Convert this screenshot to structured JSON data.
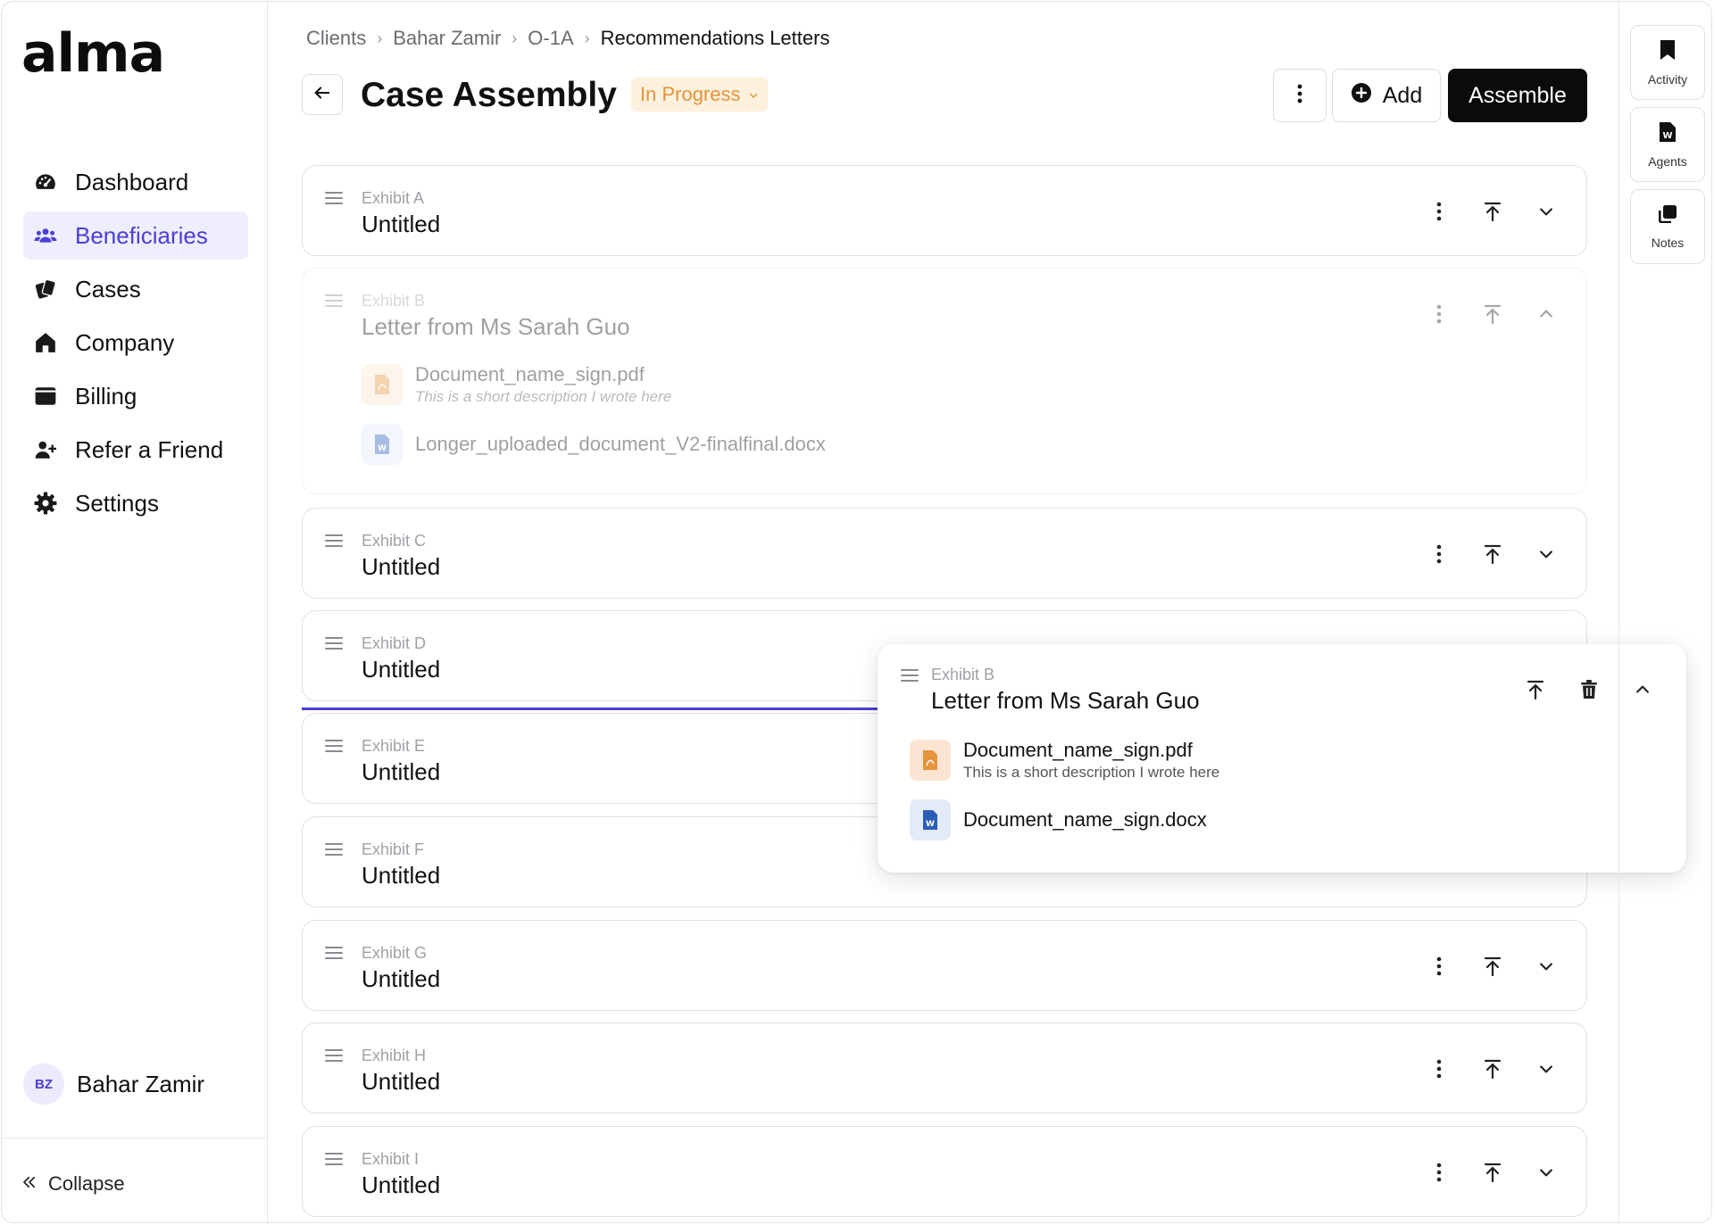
{
  "app": {
    "logo": "alma"
  },
  "sidebar": {
    "items": [
      {
        "label": "Dashboard",
        "icon": "dashboard-gauge-icon"
      },
      {
        "label": "Beneficiaries",
        "icon": "users-icon",
        "active": true
      },
      {
        "label": "Cases",
        "icon": "cases-icon"
      },
      {
        "label": "Company",
        "icon": "home-icon"
      },
      {
        "label": "Billing",
        "icon": "wallet-icon"
      },
      {
        "label": "Refer a Friend",
        "icon": "user-plus-icon"
      },
      {
        "label": "Settings",
        "icon": "gear-icon"
      }
    ],
    "user": {
      "initials": "BZ",
      "name": "Bahar Zamir"
    },
    "collapse_label": "Collapse"
  },
  "breadcrumb": [
    "Clients",
    "Bahar Zamir",
    "O-1A",
    "Recommendations Letters"
  ],
  "header": {
    "title": "Case Assembly",
    "status": "In Progress",
    "add_label": "Add",
    "assemble_label": "Assemble"
  },
  "exhibits": [
    {
      "label": "Exhibit A",
      "title": "Untitled"
    },
    {
      "label": "Exhibit B",
      "title": "Letter from Ms Sarah Guo",
      "docs": [
        {
          "name": "Document_name_sign.pdf",
          "desc": "This is a short description I wrote here"
        },
        {
          "name": "Longer_uploaded_document_V2-finalfinal.docx"
        }
      ]
    },
    {
      "label": "Exhibit C",
      "title": "Untitled"
    },
    {
      "label": "Exhibit D",
      "title": "Untitled"
    },
    {
      "label": "Exhibit E",
      "title": "Untitled"
    },
    {
      "label": "Exhibit F",
      "title": "Untitled"
    },
    {
      "label": "Exhibit G",
      "title": "Untitled"
    },
    {
      "label": "Exhibit H",
      "title": "Untitled"
    },
    {
      "label": "Exhibit I",
      "title": "Untitled"
    }
  ],
  "dragging": {
    "label": "Exhibit B",
    "title": "Letter from Ms Sarah Guo",
    "docs": [
      {
        "name": "Document_name_sign.pdf",
        "desc": "This is a short description I wrote here"
      },
      {
        "name": "Document_name_sign.docx"
      }
    ]
  },
  "rail": [
    {
      "label": "Activity",
      "icon": "bookmark-icon"
    },
    {
      "label": "Agents",
      "icon": "word-doc-icon"
    },
    {
      "label": "Notes",
      "icon": "notes-icon"
    }
  ],
  "colors": {
    "accent": "#4b3fd6",
    "status": "#e4943a",
    "pdf": "#e4943a",
    "doc": "#2b5cb8"
  }
}
